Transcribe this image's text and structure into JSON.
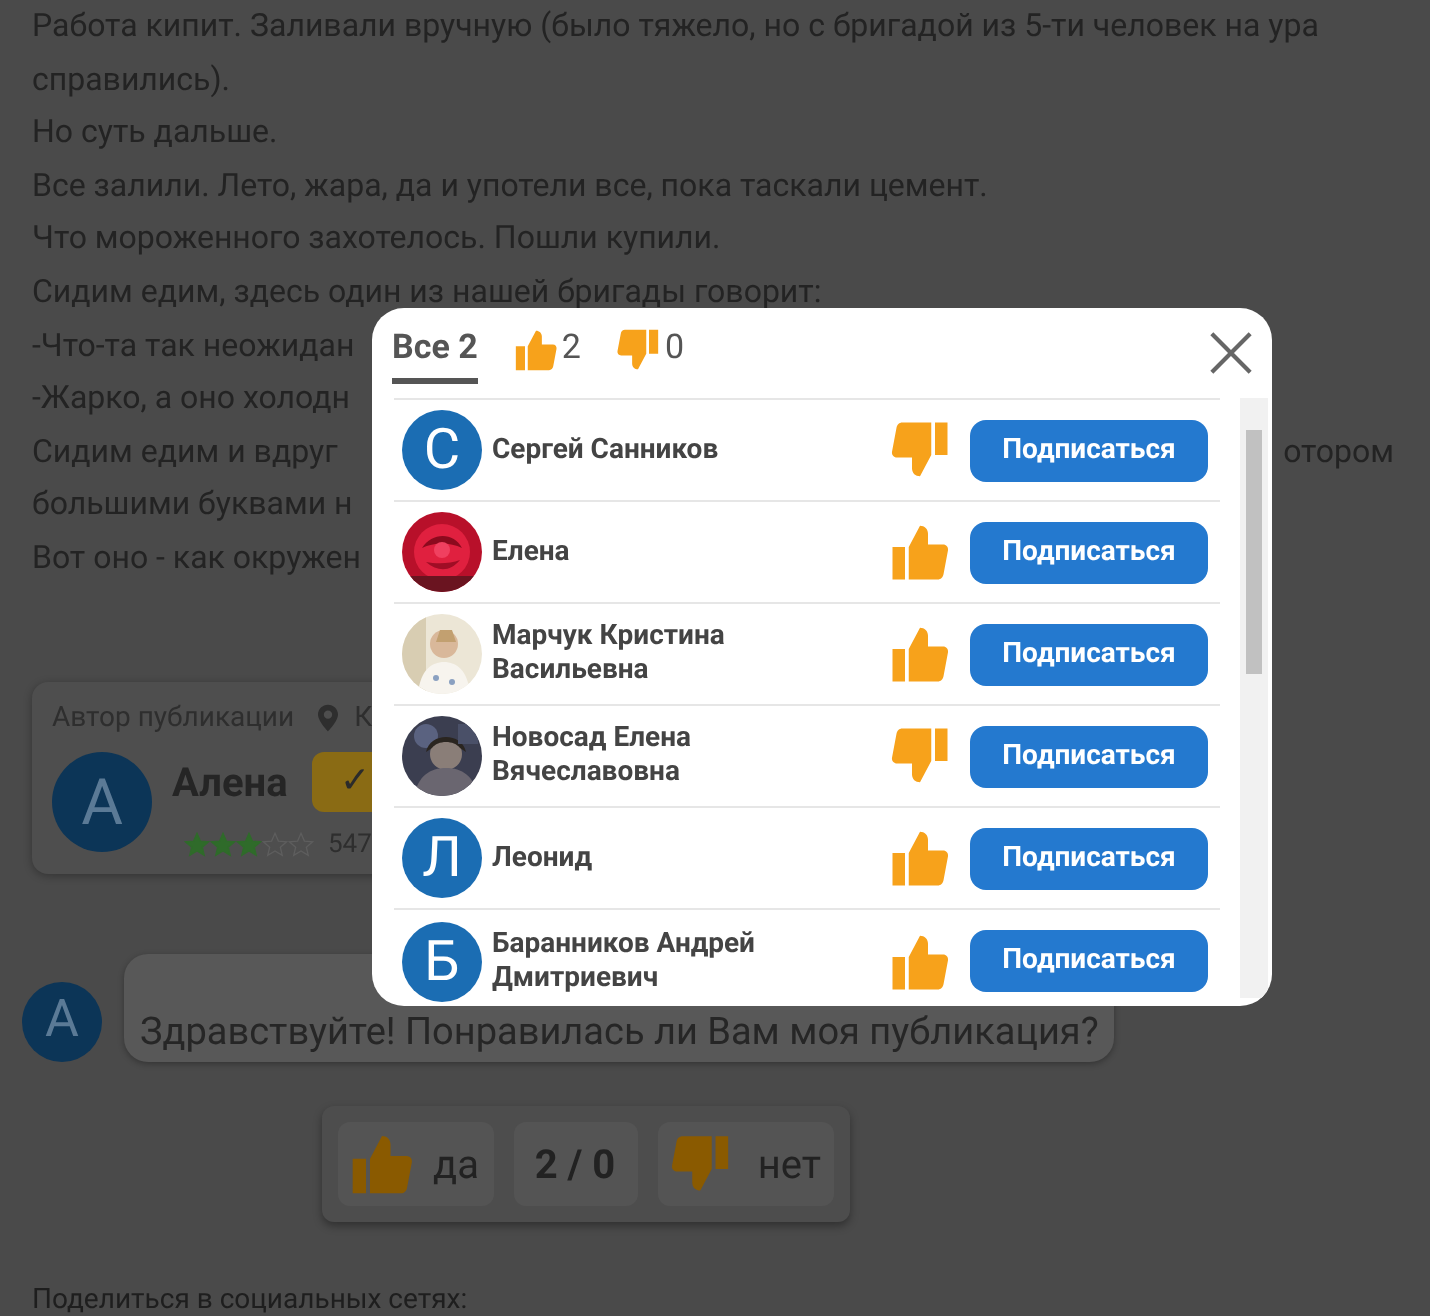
{
  "article_lines": [
    {
      "left": "Работа кипит. Заливали вручную (было тяжело, но с бригадой из 5-ти человек на ура"
    },
    {
      "left": "справились)."
    },
    {
      "left": "Но суть дальше."
    },
    {
      "left": "Все залили. Лето, жара, да и употели все, пока таскали цемент."
    },
    {
      "left": "Что мороженного захотелось. Пошли купили."
    },
    {
      "left": "Сидим едим, здесь один из нашей бригады говорит:"
    },
    {
      "left": "-Что-та так неожидан"
    },
    {
      "left": "-Жарко, а оно холодн"
    },
    {
      "left": "Сидим едим и вдруг",
      "right": "отором"
    },
    {
      "left": "большими буквами н"
    },
    {
      "left": "Вот оно - как окружен"
    }
  ],
  "author_card": {
    "label": "Автор публикации",
    "location": "К",
    "avatar_letter": "А",
    "name": "Алена",
    "badge": "✓",
    "stars": 3,
    "count": "547"
  },
  "comment": {
    "avatar_letter": "А",
    "text": "Здравствуйте! Понравилась ли Вам моя публикация?"
  },
  "poll": {
    "yes": "да",
    "score": "2 / 0",
    "no": "нет"
  },
  "share_label": "Поделиться в социальных сетях:",
  "modal": {
    "tabs": [
      {
        "kind": "all",
        "label": "Все 2",
        "selected": true
      },
      {
        "kind": "like",
        "label": "2",
        "selected": false
      },
      {
        "kind": "dislike",
        "label": "0",
        "selected": false
      }
    ],
    "users": [
      {
        "name": "Сергей Санников",
        "avatar": {
          "kind": "letter",
          "letter": "С"
        },
        "vote": {
          "kind": "dislike"
        },
        "button": "Подписаться"
      },
      {
        "name": "Елена",
        "vote": {
          "kind": "like"
        },
        "button": "Подписаться"
      },
      {
        "name": "Марчук Кристина Васильевна",
        "vote": {
          "kind": "like"
        },
        "button": "Подписаться"
      },
      {
        "name": "Новосад Елена Вячеславовна",
        "vote": {
          "kind": "dislike"
        },
        "button": "Подписаться"
      },
      {
        "name": "Леонид",
        "avatar": {
          "kind": "letter",
          "letter": "Л"
        },
        "vote": {
          "kind": "like"
        },
        "button": "Подписаться"
      },
      {
        "name": "Баранников Андрей Дмитриевич",
        "avatar": {
          "kind": "letter",
          "letter": "Б"
        },
        "vote": {
          "kind": "like"
        },
        "button": "Подписаться"
      }
    ]
  }
}
